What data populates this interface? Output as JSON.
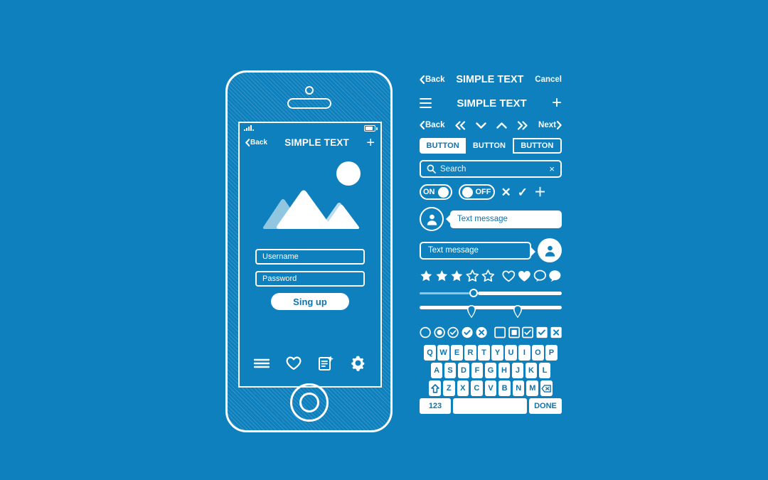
{
  "theme": {
    "bg": "#0d80bd",
    "ink": "#ffffff",
    "accent_text": "#1273ab"
  },
  "phone": {
    "status": {
      "signal_icon": "signal-bars-icon",
      "battery_icon": "battery-icon"
    },
    "navbar": {
      "back_label": "Back",
      "title": "SIMPLE TEXT",
      "add_label": "+"
    },
    "photo": {
      "image_icon": "mountains-photo-placeholder",
      "sun_icon": "sun-icon"
    },
    "form": {
      "username_placeholder": "Username",
      "password_placeholder": "Password",
      "submit_label": "Sing up"
    },
    "tabs": [
      {
        "name": "menu-icon"
      },
      {
        "name": "heart-icon"
      },
      {
        "name": "new-document-icon"
      },
      {
        "name": "gear-icon"
      }
    ],
    "home_button": "home-button"
  },
  "kit": {
    "header_bar": {
      "back_label": "Back",
      "title": "SIMPLE TEXT",
      "cancel_label": "Cancel"
    },
    "menu_bar": {
      "menu_icon": "hamburger-icon",
      "title": "SIMPLE TEXT",
      "add_label": "+"
    },
    "pager": {
      "back_label": "Back",
      "first_label": "«",
      "down_label": "⌄",
      "up_label": "⌃",
      "last_label": "»",
      "next_label": "Next"
    },
    "buttons": [
      {
        "label": "BUTTON",
        "style": "solid"
      },
      {
        "label": "BUTTON",
        "style": "flat"
      },
      {
        "label": "BUTTON",
        "style": "outline"
      }
    ],
    "search": {
      "placeholder": "Search",
      "clear_label": "×",
      "icon": "search-icon"
    },
    "toggles": [
      {
        "label": "ON",
        "state": "on"
      },
      {
        "label": "OFF",
        "state": "off"
      }
    ],
    "symbols": [
      {
        "name": "close-x-icon",
        "glyph": "✕"
      },
      {
        "name": "check-icon",
        "glyph": "✓"
      },
      {
        "name": "plus-icon",
        "glyph": "＋"
      }
    ],
    "messages": [
      {
        "text": "Text message",
        "side": "left",
        "avatar": "avatar-outline"
      },
      {
        "text": "Text message",
        "side": "right",
        "avatar": "avatar-filled"
      }
    ],
    "rating": {
      "filled_stars": 3,
      "empty_stars": 2
    },
    "reactions": [
      {
        "name": "heart-outline-icon"
      },
      {
        "name": "heart-filled-icon"
      },
      {
        "name": "comment-outline-icon"
      },
      {
        "name": "comment-filled-icon"
      }
    ],
    "sliders": [
      {
        "type": "single",
        "value_pct": 36
      },
      {
        "type": "range",
        "value_pct": [
          36,
          68
        ]
      }
    ],
    "controls": [
      {
        "name": "radio-empty",
        "shape": "circle",
        "state": "empty"
      },
      {
        "name": "radio-selected",
        "shape": "circle",
        "state": "dot"
      },
      {
        "name": "radio-check-outline",
        "shape": "circle",
        "state": "check-outline"
      },
      {
        "name": "radio-check-filled",
        "shape": "circle",
        "state": "check-filled"
      },
      {
        "name": "radio-x-filled",
        "shape": "circle",
        "state": "x-filled"
      },
      {
        "name": "checkbox-empty",
        "shape": "square",
        "state": "empty"
      },
      {
        "name": "checkbox-selected",
        "shape": "square",
        "state": "dot"
      },
      {
        "name": "checkbox-check-outline",
        "shape": "square",
        "state": "check-outline"
      },
      {
        "name": "checkbox-check-filled",
        "shape": "square",
        "state": "check-filled"
      },
      {
        "name": "checkbox-x-filled",
        "shape": "square",
        "state": "x-filled"
      }
    ],
    "keyboard": {
      "row1": [
        "Q",
        "W",
        "E",
        "R",
        "T",
        "Y",
        "U",
        "I",
        "O",
        "P"
      ],
      "row2": [
        "A",
        "S",
        "D",
        "F",
        "G",
        "H",
        "J",
        "K",
        "L"
      ],
      "row3": [
        "Z",
        "X",
        "C",
        "V",
        "B",
        "N",
        "M"
      ],
      "shift_label": "⇧",
      "backspace_label": "⌫",
      "numbers_label": "123",
      "space_label": "",
      "done_label": "DONE"
    }
  }
}
